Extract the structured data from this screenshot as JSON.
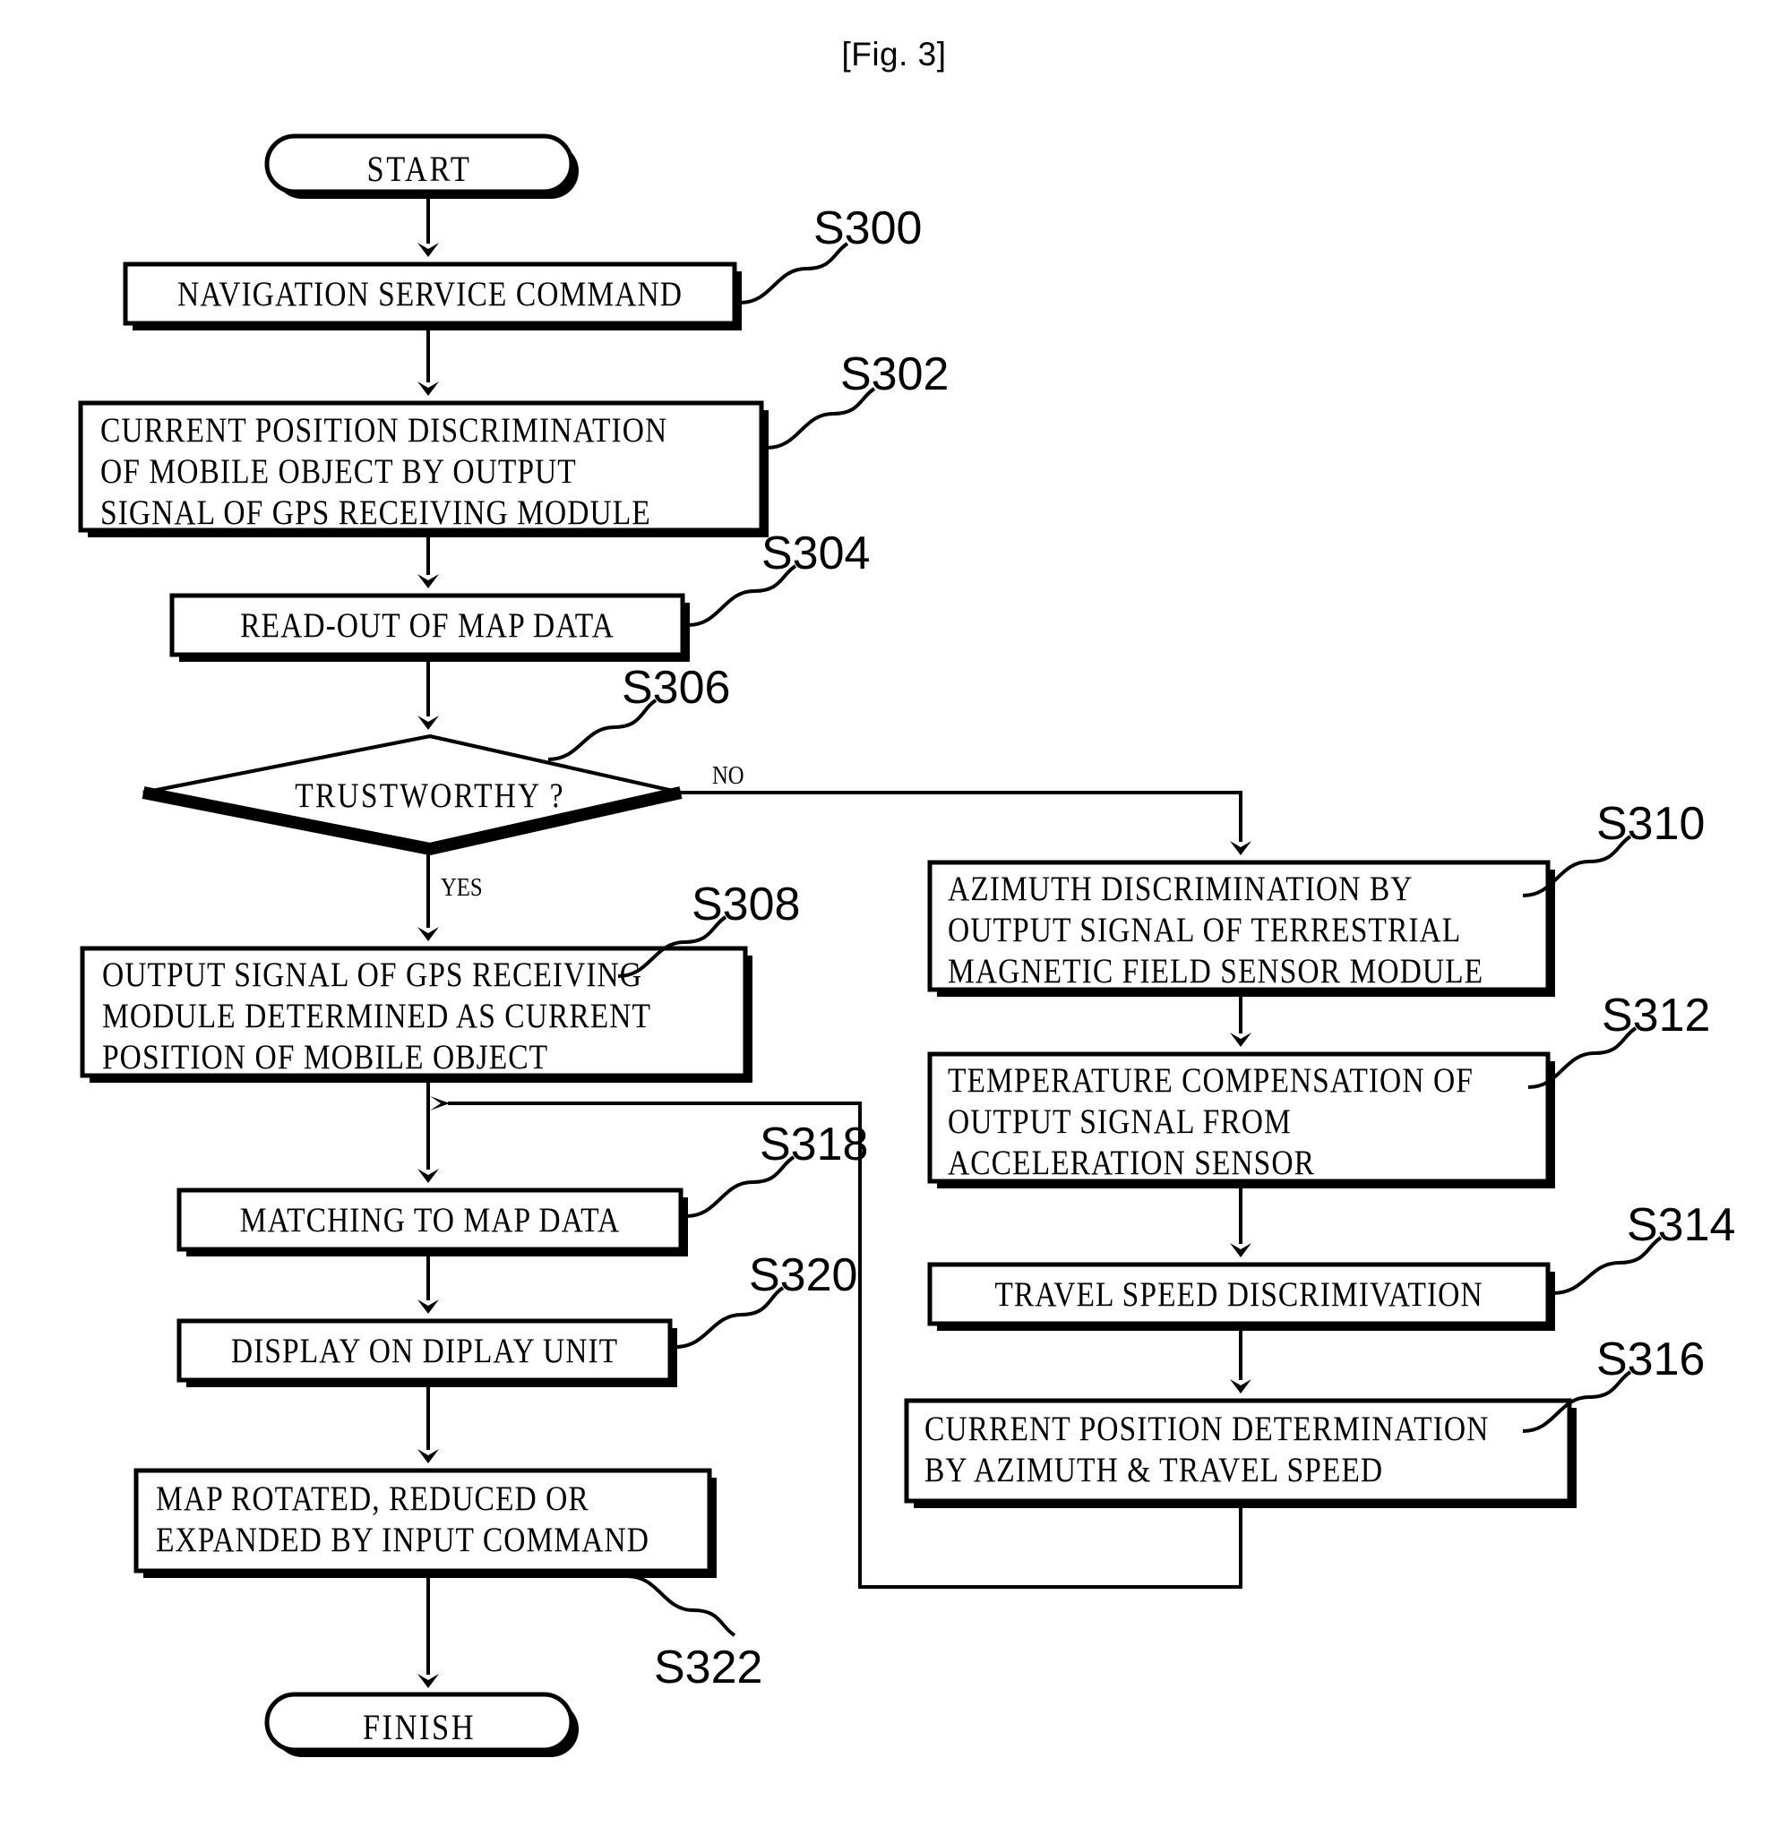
{
  "figure": {
    "title": "[Fig. 3]",
    "type": "patent-flowchart"
  },
  "nodes": {
    "start": {
      "label": "START",
      "shape": "terminator"
    },
    "s300": {
      "label": "NAVIGATION SERVICE COMMAND",
      "shape": "process"
    },
    "s302_l1": {
      "label": "CURRENT POSITION DISCRIMINATION",
      "shape": "process"
    },
    "s302_l2": {
      "label": "OF MOBILE OBJECT BY OUTPUT"
    },
    "s302_l3": {
      "label": "SIGNAL OF GPS RECEIVING MODULE"
    },
    "s304": {
      "label": "READ-OUT OF MAP DATA",
      "shape": "process"
    },
    "s306": {
      "label": "TRUSTWORTHY ?",
      "shape": "decision"
    },
    "s308_l1": {
      "label": "OUTPUT SIGNAL OF GPS RECEIVING",
      "shape": "process"
    },
    "s308_l2": {
      "label": "MODULE DETERMINED AS CURRENT"
    },
    "s308_l3": {
      "label": "POSITION OF MOBILE OBJECT"
    },
    "s310_l1": {
      "label": "AZIMUTH DISCRIMINATION BY",
      "shape": "process"
    },
    "s310_l2": {
      "label": "OUTPUT SIGNAL OF TERRESTRIAL"
    },
    "s310_l3": {
      "label": "MAGNETIC FIELD SENSOR MODULE"
    },
    "s312_l1": {
      "label": "TEMPERATURE COMPENSATION OF",
      "shape": "process"
    },
    "s312_l2": {
      "label": "OUTPUT SIGNAL FROM"
    },
    "s312_l3": {
      "label": "ACCELERATION SENSOR"
    },
    "s314": {
      "label": "TRAVEL SPEED DISCRIMIVATION",
      "shape": "process"
    },
    "s316_l1": {
      "label": "CURRENT POSITION DETERMINATION",
      "shape": "process"
    },
    "s316_l2": {
      "label": "BY AZIMUTH & TRAVEL SPEED"
    },
    "s318": {
      "label": "MATCHING TO MAP DATA",
      "shape": "process"
    },
    "s320": {
      "label": "DISPLAY ON DIPLAY UNIT",
      "shape": "process"
    },
    "s322_l1": {
      "label": "MAP ROTATED, REDUCED OR",
      "shape": "process"
    },
    "s322_l2": {
      "label": "EXPANDED BY INPUT COMMAND"
    },
    "finish": {
      "label": "FINISH",
      "shape": "terminator"
    }
  },
  "step_labels": {
    "s300": "S300",
    "s302": "S302",
    "s304": "S304",
    "s306": "S306",
    "s308": "S308",
    "s310": "S310",
    "s312": "S312",
    "s314": "S314",
    "s316": "S316",
    "s318": "S318",
    "s320": "S320",
    "s322": "S322"
  },
  "branch_labels": {
    "yes": "YES",
    "no": "NO"
  },
  "colors": {
    "ink": "#000000",
    "paper": "#ffffff"
  }
}
